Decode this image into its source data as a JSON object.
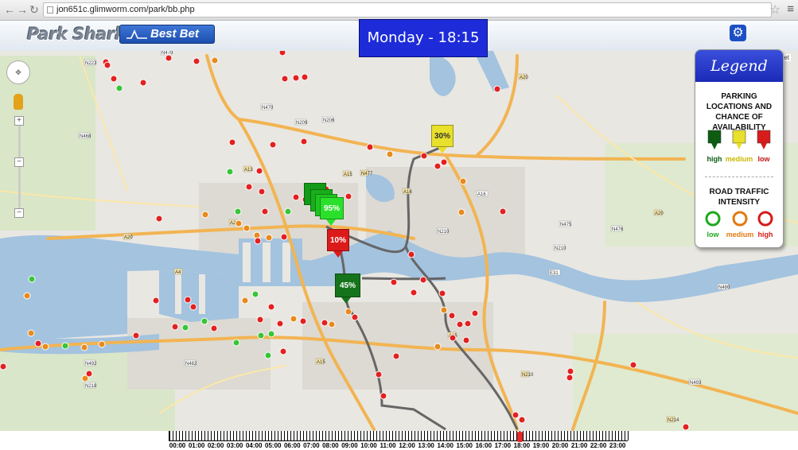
{
  "browser": {
    "url": "jon651c.glimworm.com/park/bb.php",
    "back_icon": "back-arrow-icon",
    "forward_icon": "forward-arrow-icon",
    "reload_icon": "reload-icon"
  },
  "header": {
    "logo_text": "Park Shark",
    "best_bet_label": "Best Bet",
    "time_display": "Monday - 18:15",
    "settings_icon": "gear-icon"
  },
  "legend": {
    "title": "Legend",
    "parking_heading": "PARKING LOCATIONS AND CHANCE OF AVAILABILITY",
    "parking_levels": [
      "high",
      "medium",
      "low"
    ],
    "traffic_heading": "ROAD TRAFFIC INTENSITY",
    "traffic_levels": [
      "low",
      "medium",
      "high"
    ],
    "colors": {
      "high": "#0d5c12",
      "medium": "#e8e02a",
      "low": "#d81c1c",
      "traffic_low": "#1ea81e",
      "traffic_medium": "#e07a10",
      "traffic_high": "#d61a1a"
    }
  },
  "map": {
    "attribution": "lliet",
    "labels": [
      "N223",
      "N470",
      "A13",
      "N209",
      "N206",
      "A20",
      "N468",
      "A4",
      "A20",
      "N470",
      "A16",
      "N210",
      "N475",
      "N476",
      "A20",
      "N210",
      "A15",
      "N482",
      "N480",
      "A15",
      "N492",
      "N218",
      "N493",
      "N214",
      "A15",
      "A16",
      "N210",
      "E31",
      "N477",
      "A20",
      "A13"
    ],
    "parking_markers": [
      {
        "label": "30%",
        "level": "medium"
      },
      {
        "label": "95%",
        "level": "high"
      },
      {
        "label": "10%",
        "level": "low"
      },
      {
        "label": "45%",
        "level": "high"
      }
    ]
  },
  "timeline": {
    "hours": [
      "00:00",
      "01:00",
      "02:00",
      "03:00",
      "04:00",
      "05:00",
      "06:00",
      "07:00",
      "08:00",
      "09:00",
      "10:00",
      "11:00",
      "12:00",
      "13:00",
      "14:00",
      "15:00",
      "16:00",
      "17:00",
      "18:00",
      "19:00",
      "20:00",
      "21:00",
      "22:00",
      "23:00"
    ],
    "current_time": "18:15"
  }
}
